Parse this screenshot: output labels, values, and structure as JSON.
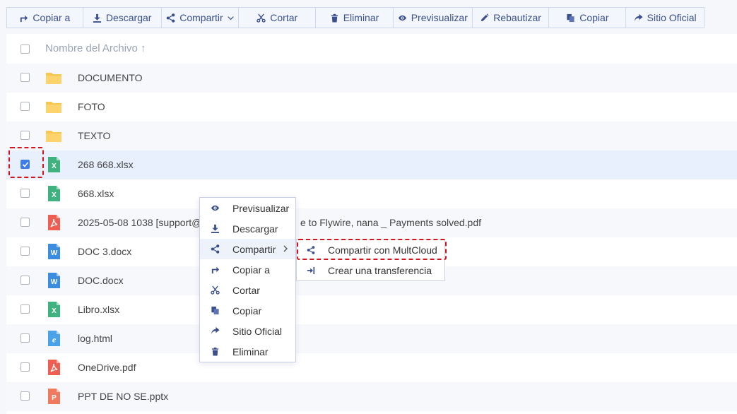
{
  "toolbar": {
    "buttons": [
      {
        "label": "Copiar a",
        "icon": "copy-to-icon"
      },
      {
        "label": "Descargar",
        "icon": "download-icon"
      },
      {
        "label": "Compartir",
        "icon": "share-icon",
        "has_dropdown": true
      },
      {
        "label": "Cortar",
        "icon": "scissors-icon"
      },
      {
        "label": "Eliminar",
        "icon": "trash-icon"
      },
      {
        "label": "Previsualizar",
        "icon": "eye-icon"
      },
      {
        "label": "Rebautizar",
        "icon": "pencil-icon"
      },
      {
        "label": "Copiar",
        "icon": "copy-icon"
      },
      {
        "label": "Sitio Oficial",
        "icon": "official-site-icon"
      }
    ]
  },
  "file_list": {
    "header": {
      "name_label": "Nombre del Archivo",
      "sort_indicator": "↑"
    },
    "rows": [
      {
        "name": "DOCUMENTO",
        "type": "folder",
        "checked": false
      },
      {
        "name": "FOTO",
        "type": "folder",
        "checked": false
      },
      {
        "name": "TEXTO",
        "type": "folder",
        "checked": false
      },
      {
        "name": "268 668.xlsx",
        "type": "excel",
        "checked": true
      },
      {
        "name": "668.xlsx",
        "type": "excel",
        "checked": false
      },
      {
        "name": "2025-05-08 1038 [support@",
        "name_tail": "e to Flywire, nana _ Payments solved.pdf",
        "type": "pdf",
        "checked": false
      },
      {
        "name": "DOC 3.docx",
        "type": "word",
        "checked": false
      },
      {
        "name": "DOC.docx",
        "type": "word",
        "checked": false
      },
      {
        "name": "Libro.xlsx",
        "type": "excel",
        "checked": false
      },
      {
        "name": "log.html",
        "type": "html",
        "checked": false
      },
      {
        "name": "OneDrive.pdf",
        "type": "pdf",
        "checked": false
      },
      {
        "name": "PPT DE NO SE.pptx",
        "type": "ppt",
        "checked": false
      }
    ]
  },
  "context_menu": {
    "items": [
      {
        "label": "Previsualizar",
        "icon": "eye-icon"
      },
      {
        "label": "Descargar",
        "icon": "download-icon"
      },
      {
        "label": "Compartir",
        "icon": "share-icon",
        "has_submenu": true,
        "active": true
      },
      {
        "label": "Copiar a",
        "icon": "copy-to-icon"
      },
      {
        "label": "Cortar",
        "icon": "scissors-icon"
      },
      {
        "label": "Copiar",
        "icon": "copy-icon"
      },
      {
        "label": "Sitio Oficial",
        "icon": "official-site-icon"
      },
      {
        "label": "Eliminar",
        "icon": "trash-icon"
      }
    ]
  },
  "submenu": {
    "items": [
      {
        "label": "Compartir con MultCloud",
        "icon": "share-icon",
        "highlighted": true
      },
      {
        "label": "Crear una transferencia",
        "icon": "transfer-icon"
      }
    ]
  },
  "colors": {
    "accent": "#3a4f8c",
    "checkbox_checked": "#3e7ce6",
    "selected_row": "#e8f0fd",
    "highlight_border": "#d4141c",
    "folder": "#f9c74f",
    "excel": "#3fb27f",
    "word": "#3b8de0",
    "pdf": "#ee5e52",
    "ppt": "#f07a5e"
  }
}
